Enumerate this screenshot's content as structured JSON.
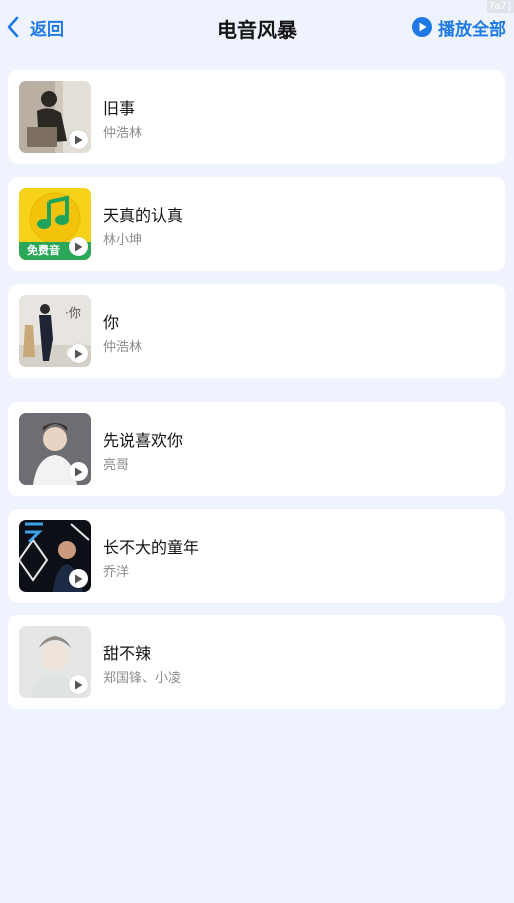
{
  "header": {
    "back_label": "返回",
    "title": "电音风暴",
    "play_all_label": "播放全部",
    "corner_badge": "7a7j"
  },
  "colors": {
    "accent": "#1f7ae8",
    "background": "#eef3fd",
    "card": "#ffffff",
    "artist_text": "#8c8c8c"
  },
  "songs": [
    {
      "title": "旧事",
      "artist": "仲浩林",
      "cover": "photo-portrait"
    },
    {
      "title": "天真的认真",
      "artist": "林小坤",
      "cover": "music-note-yellow",
      "cover_label": "免费音"
    },
    {
      "title": "你",
      "artist": "仲浩林",
      "cover": "photo-portrait"
    },
    {
      "title": "先说喜欢你",
      "artist": "亮哥",
      "cover": "photo-portrait"
    },
    {
      "title": "长不大的童年",
      "artist": "乔洋",
      "cover": "photo-portrait-dark"
    },
    {
      "title": "甜不辣",
      "artist": "郑国锋、小凌",
      "cover": "photo-portrait-light"
    }
  ]
}
